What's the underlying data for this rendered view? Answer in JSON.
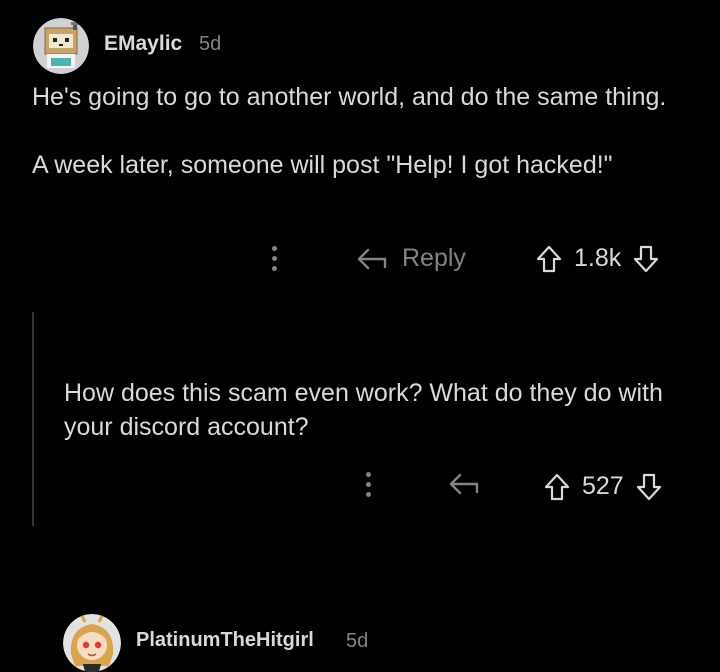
{
  "comment1": {
    "username": "EMaylic",
    "age": "5d",
    "paragraphs": [
      "He's going to go to another world, and do the same thing.",
      "A week later, someone will post \"Help! I got hacked!\""
    ],
    "reply_label": "Reply",
    "score": "1.8k"
  },
  "comment2": {
    "username": "PlatinumTheHitgirl",
    "age": "5d",
    "paragraphs": [
      "How does this scam even work? What do they do with your discord account?"
    ],
    "score": "527"
  },
  "colors": {
    "background": "#000000",
    "text": "#d7dadc",
    "muted": "#818384",
    "thread_line": "#343536"
  },
  "icons": {
    "reply": "reply-arrow-icon",
    "upvote": "upvote-arrow-icon",
    "downvote": "downvote-arrow-icon",
    "more": "more-options-icon"
  }
}
